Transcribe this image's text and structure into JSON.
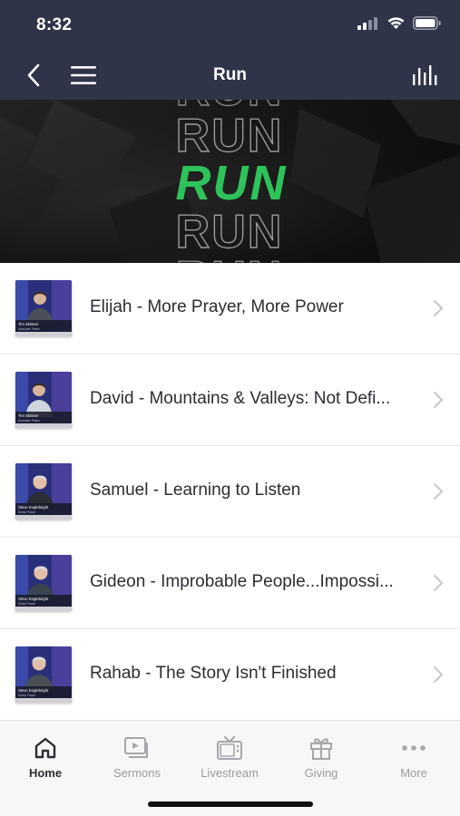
{
  "status_bar": {
    "time": "8:32"
  },
  "navbar": {
    "title": "Run"
  },
  "banner": {
    "outline_word": "RUN",
    "highlight_word": "RUN",
    "highlight_color": "#2ec35a"
  },
  "sermons": [
    {
      "title": "Elijah - More Prayer, More Power",
      "caption_name": "Tim Skinner",
      "caption_role": "Associate Pastor"
    },
    {
      "title": "David - Mountains & Valleys: Not Defi...",
      "caption_name": "Tim Skinner",
      "caption_role": "Associate Pastor"
    },
    {
      "title": "Samuel - Learning to Listen",
      "caption_name": "Steve Englebright",
      "caption_role": "Senior Pastor"
    },
    {
      "title": "Gideon - Improbable People...Impossi...",
      "caption_name": "Steve Englebright",
      "caption_role": "Senior Pastor"
    },
    {
      "title": "Rahab - The Story Isn't Finished",
      "caption_name": "Steve Englebright",
      "caption_role": "Senior Pastor"
    }
  ],
  "tabs": [
    {
      "label": "Home",
      "icon": "home-icon",
      "active": true
    },
    {
      "label": "Sermons",
      "icon": "play-video-icon",
      "active": false
    },
    {
      "label": "Livestream",
      "icon": "tv-icon",
      "active": false
    },
    {
      "label": "Giving",
      "icon": "gift-icon",
      "active": false
    },
    {
      "label": "More",
      "icon": "more-dots-icon",
      "active": false
    }
  ],
  "colors": {
    "header_bg": "#2f3449",
    "accent_green": "#2ec35a",
    "text_dark": "#2b2d33",
    "tab_inactive": "#9a9aa0"
  }
}
